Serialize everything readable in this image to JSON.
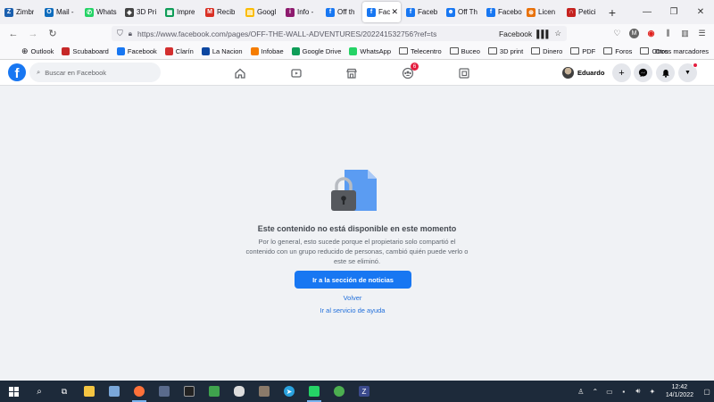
{
  "tabs": [
    {
      "label": "Zimbr",
      "icon": "zimbra-icon",
      "color": "#1b5fae",
      "glyph": "Z"
    },
    {
      "label": "Mail -",
      "icon": "outlook-icon",
      "color": "#0f6cbd",
      "glyph": "O"
    },
    {
      "label": "Whats",
      "icon": "whatsapp-icon",
      "color": "#25d366",
      "glyph": "✆"
    },
    {
      "label": "3D Pri",
      "icon": "3d-print-icon",
      "color": "#444444",
      "glyph": "◆"
    },
    {
      "label": "Impre",
      "icon": "sheets-icon",
      "color": "#0f9d58",
      "glyph": "▦"
    },
    {
      "label": "Recib",
      "icon": "gmail-icon",
      "color": "#d93025",
      "glyph": "M"
    },
    {
      "label": "Googl",
      "icon": "google-icon",
      "color": "#fbbc04",
      "glyph": "▤"
    },
    {
      "label": "Info -",
      "icon": "info-icon",
      "color": "#8e1b6e",
      "glyph": "i"
    },
    {
      "label": "Off th",
      "icon": "facebook-icon",
      "color": "#1877f2",
      "glyph": "f"
    },
    {
      "label": "Fac",
      "icon": "facebook-icon",
      "color": "#1877f2",
      "glyph": "f",
      "active": true
    },
    {
      "label": "Faceb",
      "icon": "facebook-icon",
      "color": "#1877f2",
      "glyph": "f"
    },
    {
      "label": "Off Th",
      "icon": "group-icon",
      "color": "#1877f2",
      "glyph": "☻"
    },
    {
      "label": "Facebo",
      "icon": "facebook-icon",
      "color": "#1877f2",
      "glyph": "f"
    },
    {
      "label": "Licen",
      "icon": "license-icon",
      "color": "#e8710a",
      "glyph": "⊛"
    },
    {
      "label": "Petici",
      "icon": "peticion-icon",
      "color": "#c5221f",
      "glyph": "∩"
    }
  ],
  "browser": {
    "url": "https://www.facebook.com/pages/OFF-THE-WALL-ADVENTURES/202241532756?ref=ts",
    "site_label": "Facebook"
  },
  "bookmarks": [
    {
      "label": "Outlook",
      "type": "globe"
    },
    {
      "label": "Scubaboard",
      "type": "icon",
      "color": "#c62828"
    },
    {
      "label": "Facebook",
      "type": "icon",
      "color": "#1877f2"
    },
    {
      "label": "Clarín",
      "type": "icon",
      "color": "#d32f2f"
    },
    {
      "label": "La Nacion",
      "type": "icon",
      "color": "#0d47a1"
    },
    {
      "label": "Infobae",
      "type": "icon",
      "color": "#f57c00"
    },
    {
      "label": "Google Drive",
      "type": "icon",
      "color": "#0f9d58"
    },
    {
      "label": "WhatsApp",
      "type": "icon",
      "color": "#25d366"
    },
    {
      "label": "Telecentro",
      "type": "folder"
    },
    {
      "label": "Buceo",
      "type": "folder"
    },
    {
      "label": "3D print",
      "type": "folder"
    },
    {
      "label": "Dinero",
      "type": "folder"
    },
    {
      "label": "PDF",
      "type": "folder"
    },
    {
      "label": "Foros",
      "type": "folder"
    },
    {
      "label": "Otros",
      "type": "folder"
    }
  ],
  "bookmarks_other": "Otros marcadores",
  "facebook": {
    "search_placeholder": "Buscar en Facebook",
    "groups_badge": "6",
    "user_name": "Eduardo"
  },
  "content": {
    "title": "Este contenido no está disponible en este momento",
    "body": "Por lo general, esto sucede porque el propietario solo compartió el contenido con un grupo reducido de personas, cambió quién puede verlo o este se eliminó.",
    "primary_button": "Ir a la sección de noticias",
    "back_link": "Volver",
    "help_link": "Ir al servicio de ayuda"
  },
  "taskbar": {
    "time": "12:42",
    "date": "14/1/2022"
  },
  "colors": {
    "facebook_blue": "#1877f2",
    "link_blue": "#216fdb",
    "taskbar": "#1d2a3a"
  }
}
